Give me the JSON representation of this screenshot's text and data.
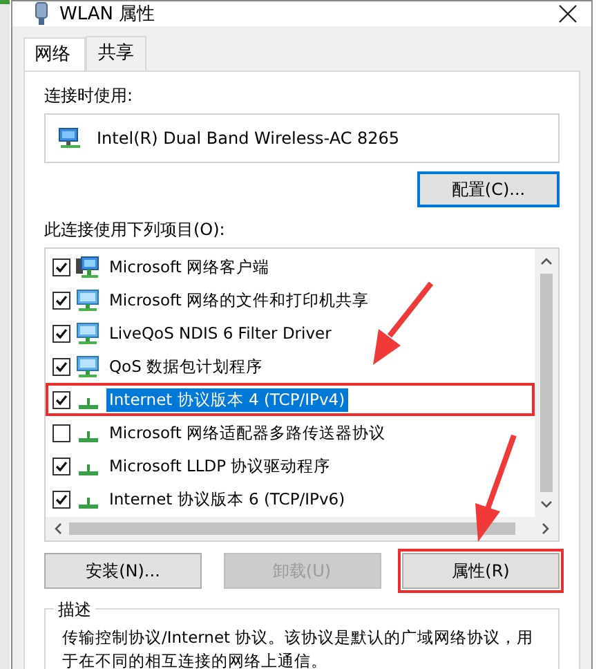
{
  "window": {
    "title": "WLAN 属性"
  },
  "tabs": [
    {
      "label": "网络",
      "selected": true
    },
    {
      "label": "共享",
      "selected": false
    }
  ],
  "connect_using": {
    "label": "连接时使用:",
    "adapter": "Intel(R) Dual Band Wireless-AC 8265"
  },
  "configure_button": "配置(C)...",
  "items_label": "此连接使用下列项目(O):",
  "items": [
    {
      "label": "Microsoft 网络客户端",
      "kind": "client",
      "checked": true,
      "selected": false,
      "annotated": false
    },
    {
      "label": "Microsoft 网络的文件和打印机共享",
      "kind": "service",
      "checked": true,
      "selected": false,
      "annotated": false
    },
    {
      "label": "LiveQoS NDIS 6 Filter Driver",
      "kind": "service",
      "checked": true,
      "selected": false,
      "annotated": false
    },
    {
      "label": "QoS 数据包计划程序",
      "kind": "service",
      "checked": true,
      "selected": false,
      "annotated": false
    },
    {
      "label": "Internet 协议版本 4 (TCP/IPv4)",
      "kind": "protocol",
      "checked": true,
      "selected": true,
      "annotated": true
    },
    {
      "label": "Microsoft 网络适配器多路传送器协议",
      "kind": "protocol",
      "checked": false,
      "selected": false,
      "annotated": false
    },
    {
      "label": "Microsoft LLDP 协议驱动程序",
      "kind": "protocol",
      "checked": true,
      "selected": false,
      "annotated": false
    },
    {
      "label": "Internet 协议版本 6 (TCP/IPv6)",
      "kind": "protocol",
      "checked": true,
      "selected": false,
      "annotated": false
    }
  ],
  "buttons": [
    {
      "label": "安装(N)...",
      "disabled": false,
      "annotated": false
    },
    {
      "label": "卸载(U)",
      "disabled": true,
      "annotated": false
    },
    {
      "label": "属性(R)",
      "disabled": false,
      "annotated": true
    }
  ],
  "description": {
    "title": "描述",
    "text": "传输控制协议/Internet 协议。该协议是默认的广域网络协议，用于在不同的相互连接的网络上通信。"
  }
}
